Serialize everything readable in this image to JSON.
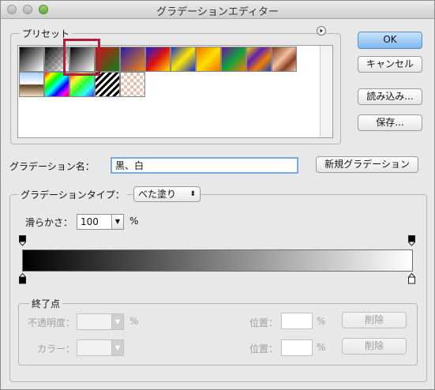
{
  "window": {
    "title": "グラデーションエディター"
  },
  "presets": {
    "label": "プリセット",
    "menu_icon": "triangle-right-circle-icon",
    "swatches": [
      {
        "name": "foreground-to-background",
        "bg": "linear-gradient(135deg,#000 0%,#fff 100%)"
      },
      {
        "name": "foreground-to-transparent",
        "bg": "linear-gradient(135deg,#000 0%,rgba(0,0,0,0) 90%), repeating-conic-gradient(#ddd 0 25%,#fff 0 50%) 0 0/8px 8px"
      },
      {
        "name": "black-white",
        "bg": "linear-gradient(135deg,#000 0%,#fff 100%)"
      },
      {
        "name": "red-green",
        "bg": "linear-gradient(135deg,#d01010 0%,#108020 100%)"
      },
      {
        "name": "violet-orange",
        "bg": "linear-gradient(135deg,#2a1ba8 0%,#f08a10 100%)"
      },
      {
        "name": "blue-red-yellow",
        "bg": "linear-gradient(135deg,#1020e0 0%,#e01010 50%,#ffe000 100%)"
      },
      {
        "name": "blue-yellow-blue",
        "bg": "linear-gradient(135deg,#1530d0 0%,#ffe800 50%,#1530d0 100%)"
      },
      {
        "name": "orange-yellow-orange",
        "bg": "linear-gradient(135deg,#f07000 0%,#ffe000 50%,#f07000 100%)"
      },
      {
        "name": "violet-green-orange",
        "bg": "linear-gradient(135deg,#7010a0 0%,#10a040 50%,#f08000 100%)"
      },
      {
        "name": "yellow-violet-orange-blue",
        "bg": "linear-gradient(135deg,#f0d000 0%,#6020b0 35%,#f08000 65%,#1840d0 100%)"
      },
      {
        "name": "copper",
        "bg": "linear-gradient(135deg,#7a3a18 0%,#f2c0a0 45%,#8a4020 70%,#f0c8b0 100%)"
      },
      {
        "name": "chrome",
        "bg": "linear-gradient(180deg,#a8d0ff 0%,#ffffff 48%,#5a4020 52%,#f0e0c0 100%)"
      },
      {
        "name": "spectrum",
        "bg": "linear-gradient(135deg,#f00 0%,#ff0 17%,#0f0 34%,#0ff 51%,#00f 68%,#f0f 85%,#f00 100%)"
      },
      {
        "name": "transparent-rainbow",
        "bg": "linear-gradient(135deg,rgba(255,0,0,0.8),rgba(255,255,0,0.8),rgba(0,255,0,0.8),rgba(0,255,255,0.8),rgba(0,0,255,0.8)), repeating-conic-gradient(#ddd 0 25%,#fff 0 50%) 0 0/8px 8px"
      },
      {
        "name": "transparent-stripes",
        "bg": "repeating-linear-gradient(135deg,#000 0 3px,#fff 3px 6px)"
      },
      {
        "name": "transparent-checker",
        "bg": "repeating-conic-gradient(#e6c2b0 0 25%,#fff 0 50%) 0 0/8px 8px"
      }
    ]
  },
  "buttons": {
    "ok": "OK",
    "cancel": "キャンセル",
    "load": "読み込み...",
    "save": "保存...",
    "new_gradient": "新規グラデーション"
  },
  "name_field": {
    "label": "グラデーション名：",
    "value": "黒、白"
  },
  "gradient_type": {
    "label": "グラデーションタイプ：",
    "value": "べた塗り",
    "smoothness_label": "滑らかさ：",
    "smoothness_value": "100",
    "unit": "%"
  },
  "stops": {
    "section_label": "終了点",
    "opacity_label": "不透明度：",
    "opacity_unit": "%",
    "color_label": "カラー：",
    "location_label": "位置：",
    "location_unit": "%",
    "delete_label": "削除",
    "color_start": "#000000",
    "color_end": "#ffffff"
  }
}
